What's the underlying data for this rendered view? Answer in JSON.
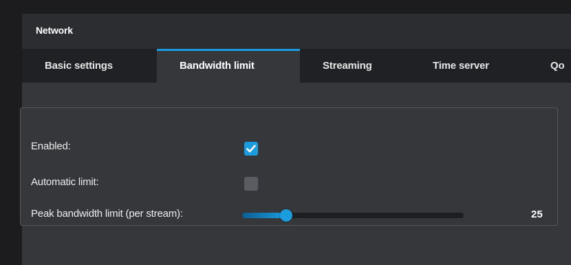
{
  "panel": {
    "title": "Network"
  },
  "tabs": {
    "basic": "Basic settings",
    "bandwidth": "Bandwidth limit",
    "streaming": "Streaming",
    "time_server": "Time server",
    "qos_partial": "Qo"
  },
  "active_tab": "Bandwidth limit",
  "settings": {
    "enabled_label": "Enabled:",
    "enabled_checked": true,
    "automatic_label": "Automatic limit:",
    "automatic_checked": false,
    "peak_label": "Peak bandwidth limit (per stream):",
    "peak_value_text": "25",
    "peak_slider_fraction": 0.2
  },
  "colors": {
    "accent": "#1a9cdf",
    "panel_bg": "#35373b",
    "header_bg": "#2c2d31",
    "tabbar_bg": "#202124"
  },
  "icons": {
    "check": "checkmark-icon"
  }
}
